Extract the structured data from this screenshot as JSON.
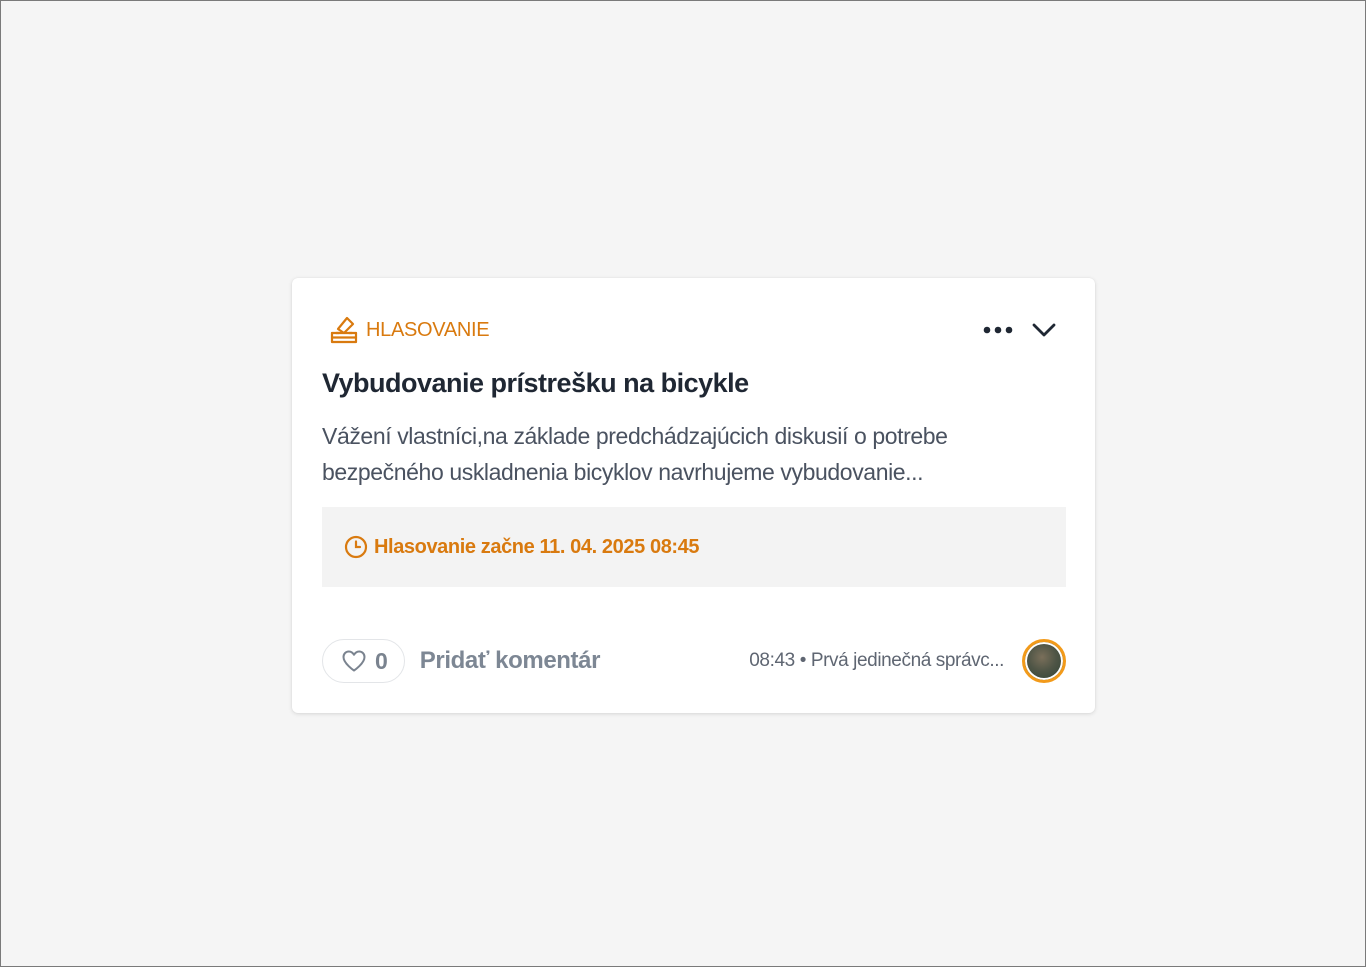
{
  "post": {
    "category_label": "HLASOVANIE",
    "category_icon": "ballot-box-icon",
    "title": "Vybudovanie prístrešku na bicykle",
    "description": "Vážení vlastníci,na základe predchádzajúcich diskusií o potrebe bezpečného uskladnenia bicyklov navrhujeme vybudovanie...",
    "status_text": "Hlasovanie začne 11. 04. 2025 08:45",
    "status_icon": "clock-icon",
    "likes": "0",
    "comment_label": "Pridať komentár",
    "meta": "08:43 • Prvá jedinečná správc..."
  },
  "colors": {
    "accent": "#d97a0f",
    "avatar_ring": "#f29a1a",
    "background": "#f5f5f5",
    "card": "#ffffff"
  }
}
